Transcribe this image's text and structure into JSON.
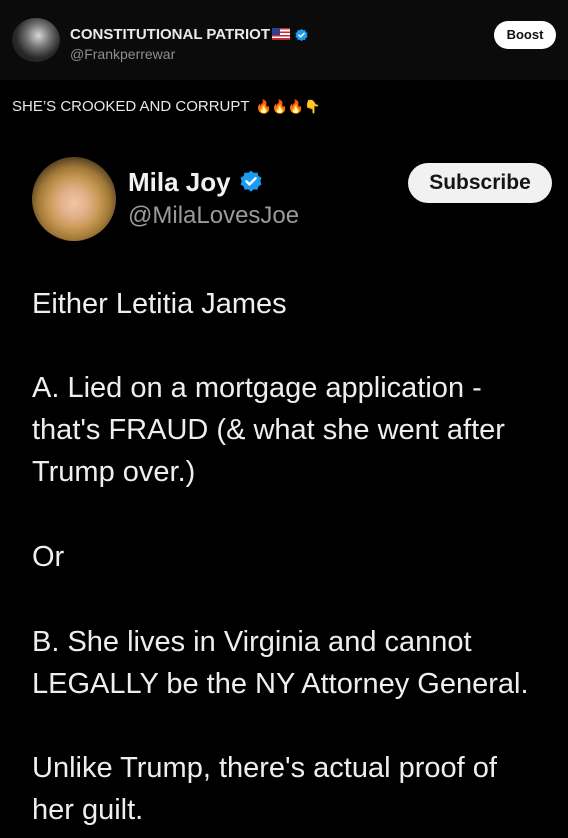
{
  "outer_post": {
    "author_name": "CONSTITUTIONAL PATRIOT",
    "flag_icon": "us-flag-icon",
    "handle": "@Frankperrewar",
    "boost_label": "Boost",
    "caption": "SHE’S CROOKED AND CORRUPT",
    "caption_emojis": "🔥🔥🔥👇"
  },
  "embedded_post": {
    "author_name": "Mila Joy",
    "handle": "@MilaLovesJoe",
    "subscribe_label": "Subscribe",
    "lines": [
      "Either Letitia James",
      "A.  Lied on a mortgage application -",
      "that's FRAUD (& what she went after",
      "Trump over.)",
      "Or",
      "B.  She lives in Virginia and cannot",
      "LEGALLY be the NY Attorney General.",
      "Unlike Trump, there's actual proof of",
      "her guilt."
    ]
  },
  "colors": {
    "background": "#000000",
    "verified_badge": "#1d9bf0"
  }
}
